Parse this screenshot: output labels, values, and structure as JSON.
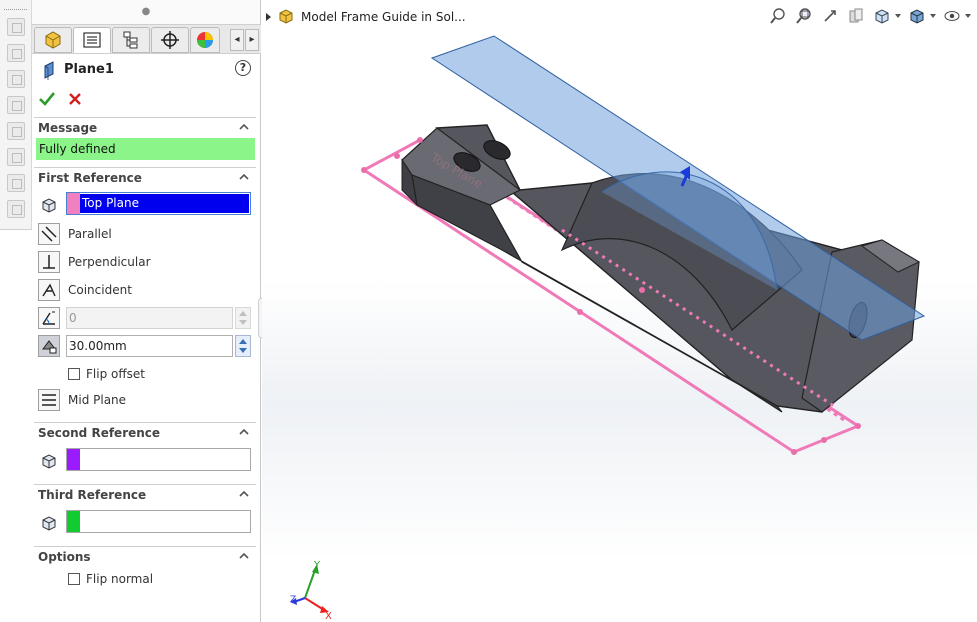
{
  "app": {
    "document_title": "Model Frame Guide in Sol..."
  },
  "panel": {
    "feature_name": "Plane1",
    "help_label": "?",
    "tabs": [
      {
        "name": "feature-manager",
        "icon": "feature-manager-icon"
      },
      {
        "name": "property-manager",
        "icon": "property-manager-icon",
        "active": true
      },
      {
        "name": "configuration-manager",
        "icon": "configuration-icon"
      },
      {
        "name": "dim-xpert-manager",
        "icon": "target-icon"
      },
      {
        "name": "display-manager",
        "icon": "appearance-icon"
      }
    ],
    "tab_scroll": {
      "left": "◂",
      "right": "▸"
    },
    "sections": {
      "message": {
        "title": "Message",
        "text": "Fully defined",
        "color": "#8cf58a"
      },
      "first_reference": {
        "title": "First Reference",
        "selection": "Top Plane",
        "swatch_color": "#f080c0",
        "constraints": [
          {
            "label": "Parallel",
            "icon": "parallel-icon"
          },
          {
            "label": "Perpendicular",
            "icon": "perpendicular-icon"
          },
          {
            "label": "Coincident",
            "icon": "coincident-icon"
          }
        ],
        "angle_value": "0",
        "offset_value": "30.00mm",
        "flip_offset_label": "Flip offset",
        "flip_offset_checked": false,
        "mid_plane_label": "Mid Plane"
      },
      "second_reference": {
        "title": "Second Reference",
        "selection": "",
        "swatch_color": "#9b1bff"
      },
      "third_reference": {
        "title": "Third Reference",
        "selection": "",
        "swatch_color": "#10cc30"
      },
      "options": {
        "title": "Options",
        "flip_normal_label": "Flip normal",
        "flip_normal_checked": false
      }
    }
  },
  "viewport": {
    "triad": {
      "x": "X",
      "y": "Y",
      "z": "Z"
    },
    "plane_label": "Top Plane",
    "colors": {
      "preview_plane": "#6fa0dc",
      "reference_plane": "#f07ab8",
      "part_body": "#4a4a52",
      "selection": "#0000ee",
      "normal_arrow": "#1a3bd8"
    },
    "heads_up_icons": [
      "zoom-to-fit-icon",
      "zoom-to-area-icon",
      "previous-view-icon",
      "section-view-icon",
      "view-orientation-icon",
      "display-style-icon",
      "hide-show-items-icon"
    ]
  }
}
